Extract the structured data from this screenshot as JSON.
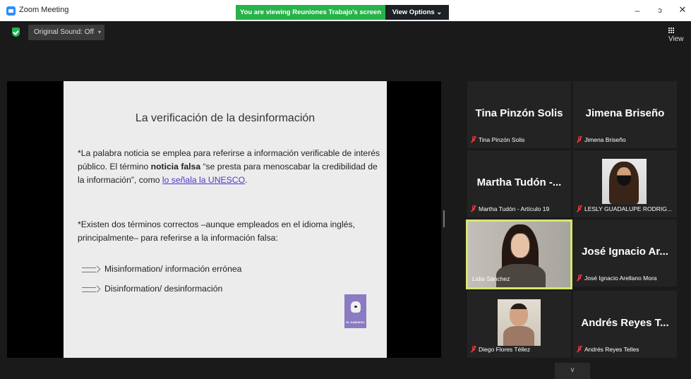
{
  "window": {
    "title": "Zoom Meeting",
    "share_banner": "You are viewing Reuniones Trabajo's screen",
    "view_options": "View Options ⌄",
    "minimize": "–",
    "maximize": "ɔ",
    "close": "✕"
  },
  "toolbar": {
    "original_sound": "Original Sound: Off",
    "sound_dropdown": "▾",
    "view": "View"
  },
  "slide": {
    "title": "La verificación de la desinformación",
    "para1_a": "*La palabra noticia se emplea para referirse a información verificable de interés público. El término ",
    "para1_bold": "noticia falsa",
    "para1_b": " “se presta para menoscabar la credibilidad de la información”, como ",
    "para1_link": "lo señala la UNESCO",
    "para1_c": ".",
    "para2": "*Existen dos términos correctos –aunque empleados en el idioma inglés, principalmente– para referirse a la información falsa:",
    "bullet1": "Misinformation/ información errónea",
    "bullet2": "Disinformation/ desinformación",
    "logo_text": "EL SABUESO"
  },
  "participants": {
    "tina": {
      "display": "Tina Pinzón Solis",
      "caption": "Tina Pinzón Solis"
    },
    "jimena": {
      "display": "Jimena Briseño",
      "caption": "Jimena Briseño"
    },
    "martha": {
      "display": "Martha Tudón -...",
      "caption": "Martha Tudón - Artículo 19"
    },
    "lesly": {
      "caption": "LESLY GUADALUPE RODRIG..."
    },
    "lidia": {
      "caption": "Lidia Sánchez"
    },
    "jose": {
      "display": "José Ignacio Ar...",
      "caption": "José Ignacio Arellano Mora"
    },
    "diego": {
      "caption": "Diego Flores Téllez"
    },
    "andres": {
      "display": "Andrés Reyes T...",
      "caption": "Andrés Reyes Telles"
    }
  },
  "gallery": {
    "scroll_down": "∨"
  },
  "colors": {
    "share_green": "#27b34a",
    "active_speaker_border": "#d6e66e",
    "muted_red": "#e0393e",
    "link": "#4b39c8"
  },
  "icons": [
    "zoom-logo-icon",
    "shield-icon",
    "grid-icon",
    "mic-muted-icon",
    "chevron-down-icon"
  ]
}
